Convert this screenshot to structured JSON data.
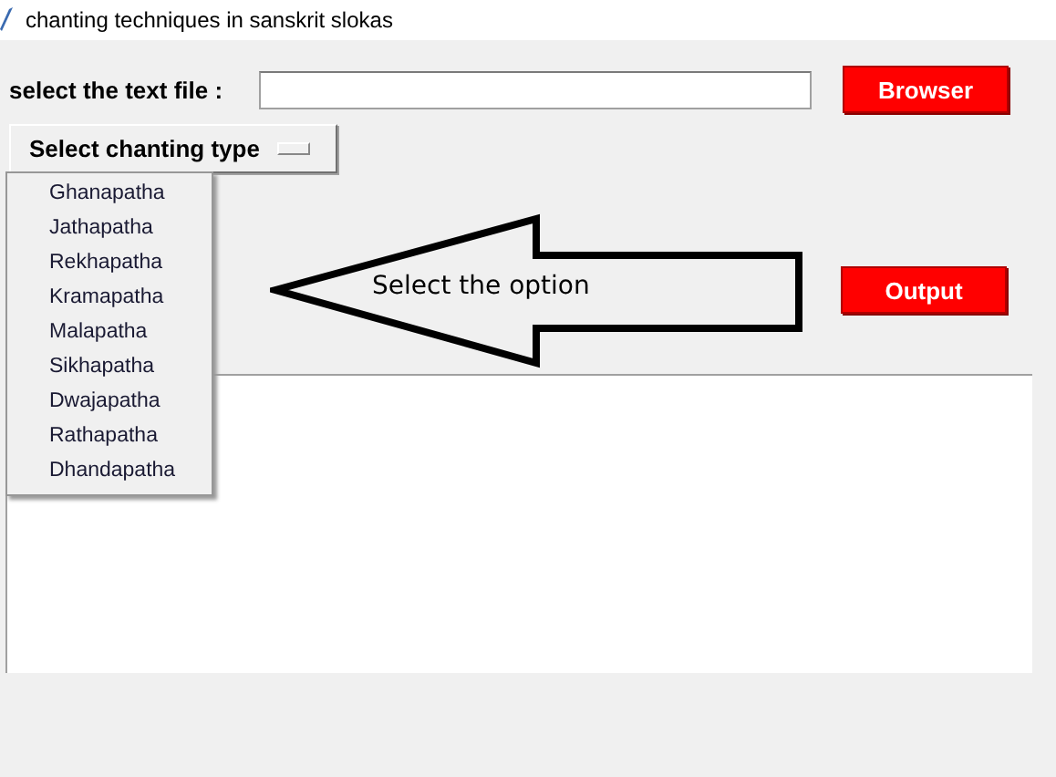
{
  "window": {
    "title": "chanting techniques in sanskrit slokas"
  },
  "file_label": "select the text file :",
  "browse_button": "Browser",
  "chanting_menu": {
    "label": "Select chanting type",
    "items": [
      {
        "label": "Ghanapatha"
      },
      {
        "label": "Jathapatha"
      },
      {
        "label": "Rekhapatha"
      },
      {
        "label": "Kramapatha"
      },
      {
        "label": "Malapatha"
      },
      {
        "label": "Sikhapatha"
      },
      {
        "label": "Dwajapatha"
      },
      {
        "label": "Rathapatha"
      },
      {
        "label": "Dhandapatha"
      }
    ]
  },
  "callout": {
    "text": "Select the option"
  },
  "output_button": "Output"
}
